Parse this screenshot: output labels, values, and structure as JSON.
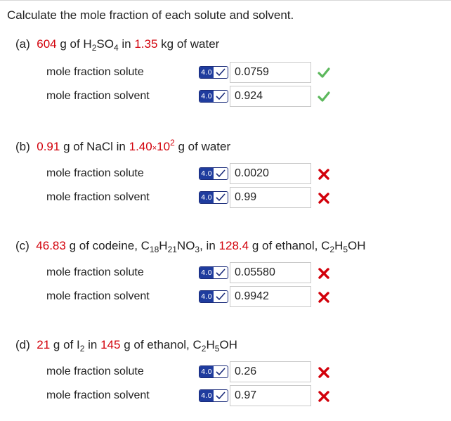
{
  "title": "Calculate the mole fraction of each solute and solvent.",
  "labels": {
    "solute": "mole fraction solute",
    "solvent": "mole fraction solvent"
  },
  "badge_text": "4.0",
  "colors": {
    "red": "#d2000a",
    "correct": "#5cb85c",
    "incorrect": "#d2000a",
    "badge_bg": "#1f3c9e"
  },
  "parts": [
    {
      "tag": "(a)",
      "q": {
        "mass1": "604",
        "g1": "g of H",
        "sub1": "2",
        "so": "SO",
        "sub2": "4",
        "in": "in",
        "mass2": "1.35",
        "rest": "kg of water"
      },
      "solute_value": "0.0759",
      "solute_status": "correct",
      "solvent_value": "0.924",
      "solvent_status": "correct"
    },
    {
      "tag": "(b)",
      "q": {
        "mass1": "0.91",
        "g1": "g of NaCl in",
        "coef": "1.40",
        "times": "×",
        "base": "10",
        "exp": "2",
        "rest": "g of water"
      },
      "solute_value": "0.0020",
      "solute_status": "incorrect",
      "solvent_value": "0.99",
      "solvent_status": "incorrect"
    },
    {
      "tag": "(c)",
      "q": {
        "mass1": "46.83",
        "g1": "g of codeine, C",
        "s1": "18",
        "h": "H",
        "s2": "21",
        "no": "NO",
        "s3": "3",
        "comma": ", in",
        "mass2": "128.4",
        "rest": "g of ethanol, C",
        "e1": "2",
        "eh": "H",
        "e2": "5",
        "oh": "OH"
      },
      "solute_value": "0.05580",
      "solute_status": "incorrect",
      "solvent_value": "0.9942",
      "solvent_status": "incorrect"
    },
    {
      "tag": "(d)",
      "q": {
        "mass1": "21",
        "g1": "g of I",
        "s1": "2",
        "in": "in",
        "mass2": "145",
        "rest": "g of ethanol, C",
        "e1": "2",
        "eh": "H",
        "e2": "5",
        "oh": "OH"
      },
      "solute_value": "0.26",
      "solute_status": "incorrect",
      "solvent_value": "0.97",
      "solvent_status": "incorrect"
    }
  ]
}
